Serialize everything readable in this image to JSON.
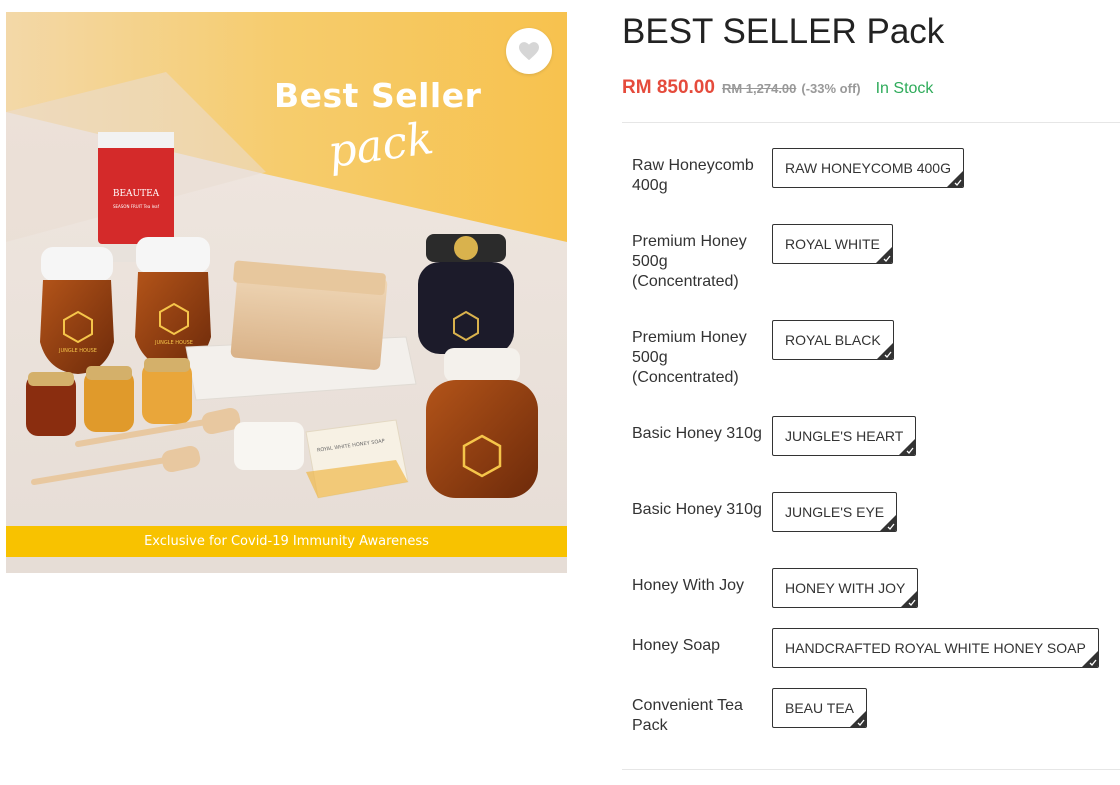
{
  "product_image": {
    "headline": "Best Seller",
    "script_text": "pack",
    "banner_text": "Exclusive for Covid-19 Immunity Awareness",
    "tea_pouch_brand": "BEAUTEA",
    "tea_pouch_subtext": "SEASON FRUIT Tea leaf",
    "bottle_brand": "JUNGLE HOUSE",
    "soap_box_text": "ROYAL WHITE HONEY SOAP",
    "wishlist_icon": "heart-icon"
  },
  "product": {
    "title": "BEST SELLER Pack",
    "price_current": "RM 850.00",
    "price_original": "RM 1,274.00",
    "discount": "(-33% off)",
    "stock_status": "In Stock"
  },
  "bundle_items": [
    {
      "label": "Raw Honeycomb 400g",
      "selected_option": "RAW HONEYCOMB 400G"
    },
    {
      "label": "Premium Honey 500g (Concentrated)",
      "selected_option": "ROYAL WHITE"
    },
    {
      "label": "Premium Honey 500g (Concentrated)",
      "selected_option": "ROYAL BLACK"
    },
    {
      "label": "Basic Honey 310g",
      "selected_option": "JUNGLE'S HEART"
    },
    {
      "label": "Basic Honey 310g",
      "selected_option": "JUNGLE'S EYE"
    },
    {
      "label": "Honey With Joy",
      "selected_option": "HONEY WITH JOY"
    },
    {
      "label": "Honey Soap",
      "selected_option": "HANDCRAFTED ROYAL WHITE HONEY SOAP"
    },
    {
      "label": "Convenient Tea Pack",
      "selected_option": "BEAU TEA"
    }
  ],
  "colors": {
    "price": "#e54b3c",
    "in_stock": "#2eab5a",
    "banner": "#f8c200",
    "chip_border": "#333333"
  }
}
